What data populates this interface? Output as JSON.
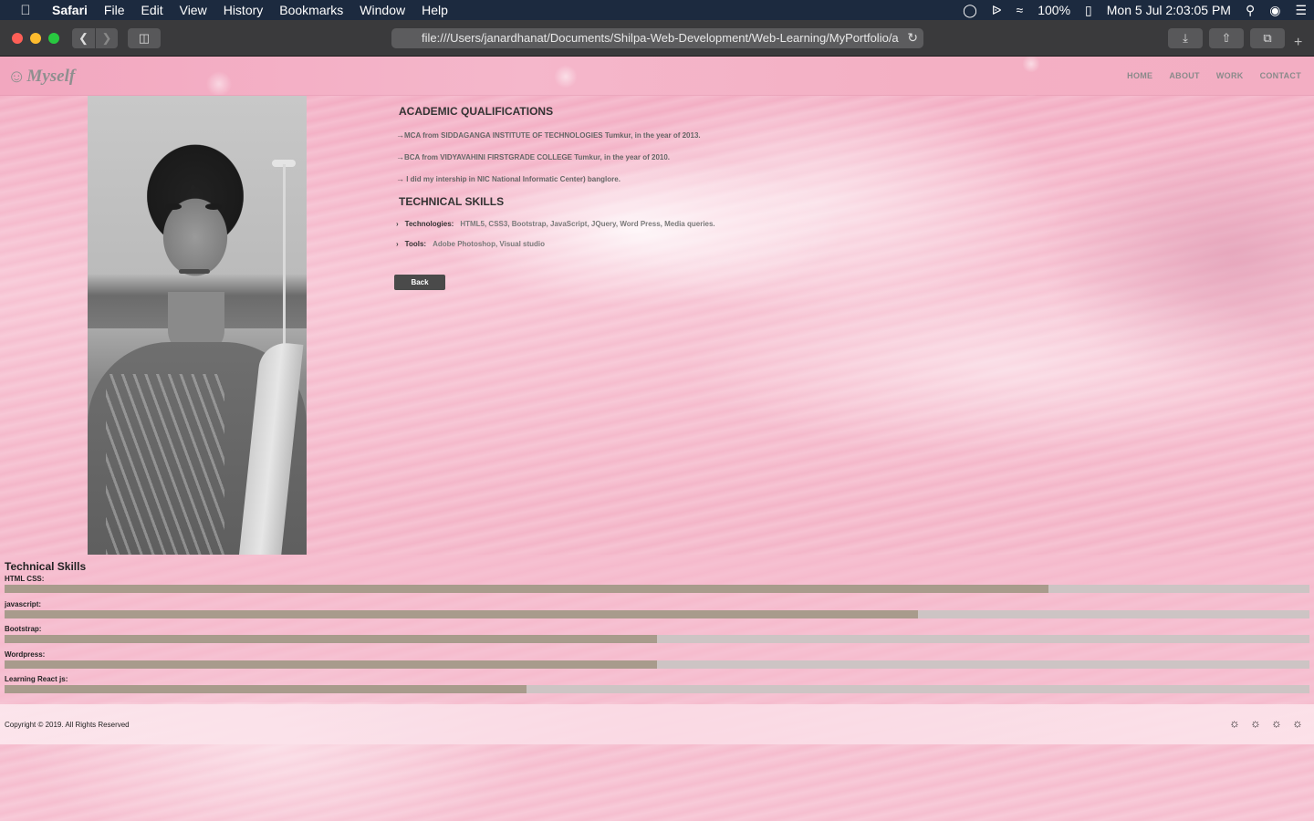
{
  "menubar": {
    "app": "Safari",
    "items": [
      "File",
      "Edit",
      "View",
      "History",
      "Bookmarks",
      "Window",
      "Help"
    ],
    "battery": "100%",
    "datetime": "Mon 5 Jul  2:03:05 PM"
  },
  "browser": {
    "url": "file:///Users/janardhanat/Documents/Shilpa-Web-Development/Web-Learning/MyPortfolio/a"
  },
  "site": {
    "logo": "Myself",
    "nav": [
      "HOME",
      "ABOUT",
      "WORK",
      "CONTACT"
    ]
  },
  "academic": {
    "title": "ACADEMIC QUALIFICATIONS",
    "items": [
      "MCA from SIDDAGANGA INSTITUTE OF TECHNOLOGIES Tumkur, in the year of 2013.",
      "BCA from VIDYAVAHINI FIRSTGRADE COLLEGE Tumkur, in the year of 2010.",
      " I did my intership in NIC National Informatic Center) banglore."
    ]
  },
  "technical": {
    "title": "TECHNICAL SKILLS",
    "technologies_label": "Technologies:",
    "technologies": "HTML5, CSS3, Bootstrap, JavaScript, JQuery, Word Press, Media queries.",
    "tools_label": "Tools:",
    "tools": "Adobe Photoshop, Visual studio",
    "back_label": "Back"
  },
  "skill_bars": {
    "title": "Technical Skills",
    "items": [
      {
        "label": "HTML CSS:",
        "level": 0.8
      },
      {
        "label": "javascript:",
        "level": 0.7
      },
      {
        "label": "Bootstrap:",
        "level": 0.5
      },
      {
        "label": "Wordpress:",
        "level": 0.5
      },
      {
        "label": "Learning React js:",
        "level": 0.4
      }
    ]
  },
  "footer": {
    "copyright": "Copyright © 2019. All Rights Reserved",
    "social_icons": [
      "social-icon-1",
      "social-icon-2",
      "social-icon-3",
      "social-icon-4"
    ]
  }
}
